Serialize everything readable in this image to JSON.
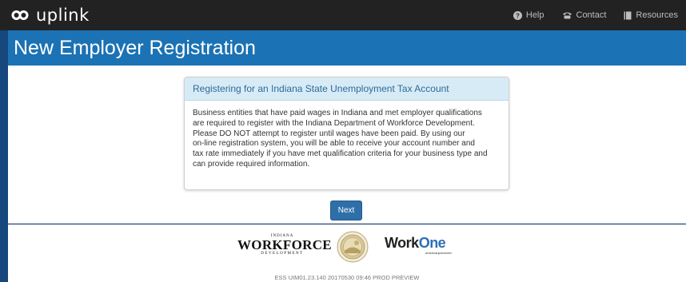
{
  "header": {
    "app_name": "uplink",
    "nav": [
      {
        "label": "Help",
        "icon": "help-icon"
      },
      {
        "label": "Contact",
        "icon": "phone-icon"
      },
      {
        "label": "Resources",
        "icon": "book-icon"
      }
    ]
  },
  "page": {
    "title": "New Employer Registration"
  },
  "panel": {
    "heading": "Registering for an Indiana State Unemployment Tax Account",
    "lines": [
      "Business entities that have paid wages in Indiana and met employer qualifications",
      "are required to register with the Indiana Department of Workforce Development.",
      "Please DO NOT attempt to register until wages have been paid. By using our",
      "on-line registration system, you will be able to receive your account number and",
      "tax rate immediately if you have met qualification criteria for your business type and",
      "can provide required information."
    ]
  },
  "actions": {
    "next_label": "Next"
  },
  "footer": {
    "workforce_logo": {
      "top": "INDIANA",
      "main": "WORKFORCE",
      "sub": "DEVELOPMENT"
    },
    "workone_logo": {
      "work": "Work",
      "one": "One",
      "tagline": "americanjobcenter"
    },
    "version": "ESS UIM01.23.140 20170530 09:46 PROD PREVIEW"
  },
  "colors": {
    "topbar": "#222222",
    "title_band": "#1b72b4",
    "side_background": "#16477d",
    "panel_heading_bg": "#d7ebf6",
    "next_button": "#2f6fa9"
  }
}
